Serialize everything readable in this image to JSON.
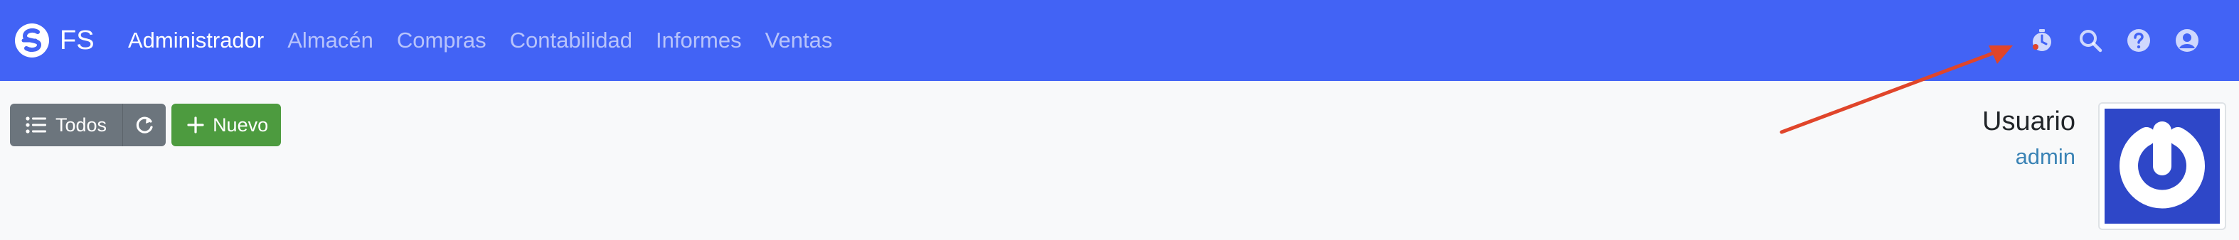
{
  "brand": {
    "logo_icon": "fs-logo-icon",
    "name": "FS"
  },
  "nav": {
    "items": [
      {
        "label": "Administrador",
        "active": true
      },
      {
        "label": "Almacén",
        "active": false
      },
      {
        "label": "Compras",
        "active": false
      },
      {
        "label": "Contabilidad",
        "active": false
      },
      {
        "label": "Informes",
        "active": false
      },
      {
        "label": "Ventas",
        "active": false
      }
    ],
    "icons": [
      "stopwatch-icon",
      "search-icon",
      "help-icon",
      "user-circle-icon"
    ]
  },
  "toolbar": {
    "todos_label": "Todos",
    "nuevo_label": "Nuevo"
  },
  "profile": {
    "title": "Usuario",
    "username": "admin",
    "avatar_icon": "power-icon"
  },
  "colors": {
    "navbar": "#4263f5",
    "secondary_button": "#6c757d",
    "success_button": "#4d9b3f",
    "link": "#3a83b5",
    "avatar_bg": "#2e47c8",
    "annotation_arrow": "#e0452a"
  }
}
